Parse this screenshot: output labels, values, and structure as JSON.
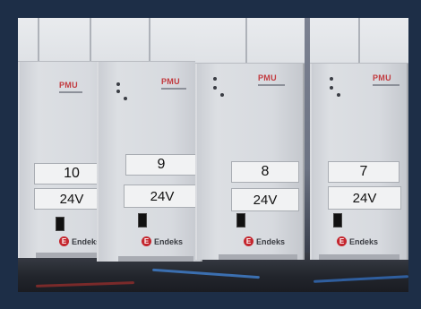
{
  "modules": [
    {
      "number": "10",
      "voltage": "24V",
      "model": "PMU",
      "brand": "Endeks"
    },
    {
      "number": "9",
      "voltage": "24V",
      "model": "PMU",
      "brand": "Endeks"
    },
    {
      "number": "8",
      "voltage": "24V",
      "model": "PMU",
      "brand": "Endeks"
    },
    {
      "number": "7",
      "voltage": "24V",
      "model": "PMU",
      "brand": "Endeks"
    }
  ],
  "colors": {
    "frame": "#1d2e47",
    "module_body": "#d7dadf",
    "brand_red": "#c4262e"
  }
}
